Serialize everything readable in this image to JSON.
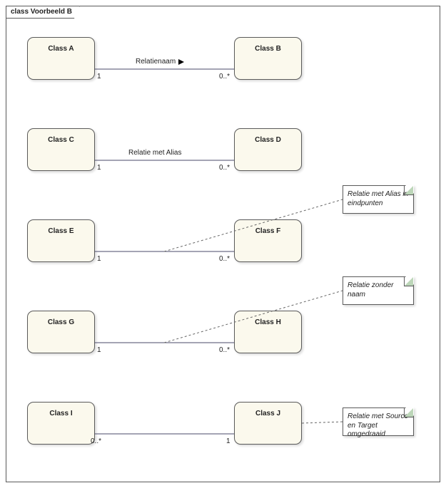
{
  "frame": {
    "title": "class Voorbeeld B"
  },
  "classes": {
    "A": {
      "name": "Class A"
    },
    "B": {
      "name": "Class B"
    },
    "C": {
      "name": "Class C"
    },
    "D": {
      "name": "Class D"
    },
    "E": {
      "name": "Class E"
    },
    "F": {
      "name": "Class F"
    },
    "G": {
      "name": "Class G"
    },
    "H": {
      "name": "Class H"
    },
    "I": {
      "name": "Class I"
    },
    "J": {
      "name": "Class J"
    }
  },
  "relations": {
    "r1": {
      "label": "Relatienaam",
      "direction_arrow": true,
      "source": {
        "class": "A",
        "multiplicity": "1"
      },
      "target": {
        "class": "B",
        "multiplicity": "0..*"
      }
    },
    "r2": {
      "label": "Relatie met Alias",
      "source": {
        "class": "C",
        "multiplicity": "1"
      },
      "target": {
        "class": "D",
        "multiplicity": "0..*"
      }
    },
    "r3": {
      "label": null,
      "note": "Relatie met Alias in eindpunten",
      "source": {
        "class": "E",
        "multiplicity": "1"
      },
      "target": {
        "class": "F",
        "multiplicity": "0..*"
      }
    },
    "r4": {
      "label": null,
      "note": "Relatie zonder naam",
      "source": {
        "class": "G",
        "multiplicity": "1"
      },
      "target": {
        "class": "H",
        "multiplicity": "0..*"
      }
    },
    "r5": {
      "label": null,
      "note": "Relatie met Source en Target omgedraaid",
      "source": {
        "class": "J",
        "multiplicity": "1"
      },
      "target": {
        "class": "I",
        "multiplicity": "0..*"
      }
    }
  },
  "chart_data": {
    "type": "table",
    "title": "class Voorbeeld B",
    "columns": [
      "relation_label",
      "note",
      "source_class",
      "source_multiplicity",
      "target_class",
      "target_multiplicity",
      "direction_arrow"
    ],
    "rows": [
      [
        "Relatienaam",
        null,
        "Class A",
        "1",
        "Class B",
        "0..*",
        true
      ],
      [
        "Relatie met Alias",
        null,
        "Class C",
        "1",
        "Class D",
        "0..*",
        false
      ],
      [
        null,
        "Relatie met Alias in eindpunten",
        "Class E",
        "1",
        "Class F",
        "0..*",
        false
      ],
      [
        null,
        "Relatie zonder naam",
        "Class G",
        "1",
        "Class H",
        "0..*",
        false
      ],
      [
        null,
        "Relatie met Source en Target omgedraaid",
        "Class J",
        "1",
        "Class I",
        "0..*",
        false
      ]
    ]
  }
}
